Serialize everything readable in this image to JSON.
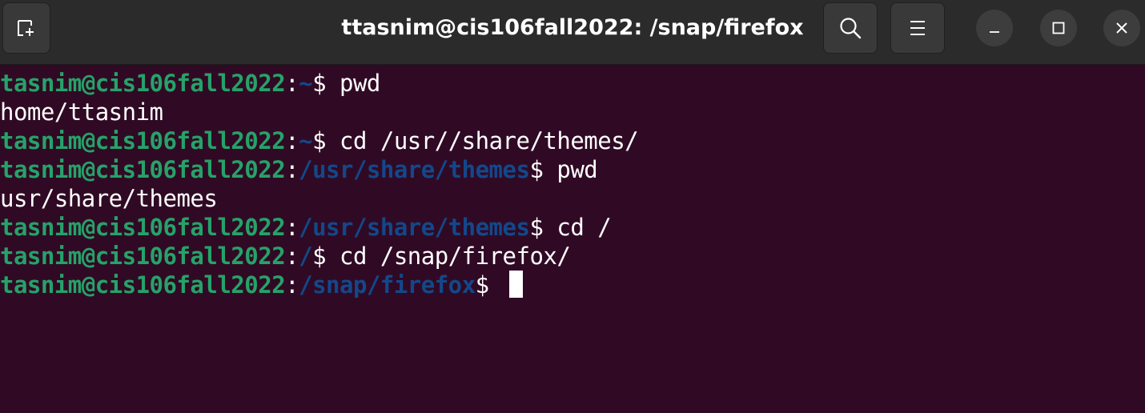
{
  "window": {
    "title": "ttasnim@cis106fall2022: /snap/firefox"
  },
  "headerbar": {
    "new_tab_icon": "new-tab-icon",
    "search_icon": "search-icon",
    "menu_icon": "hamburger-menu-icon",
    "minimize_icon": "minimize-icon",
    "maximize_icon": "maximize-icon",
    "close_icon": "close-icon"
  },
  "colors": {
    "terminal_bg": "#300a24",
    "header_bg": "#2b2b2b",
    "prompt_user": "#26a269",
    "prompt_path": "#12488b",
    "text": "#ffffff"
  },
  "terminal": {
    "lines": [
      {
        "type": "prompt",
        "user": "tasnim@cis106fall2022",
        "sep": ":",
        "path": "~",
        "cmd": "$ pwd"
      },
      {
        "type": "output",
        "text": "home/ttasnim"
      },
      {
        "type": "prompt",
        "user": "tasnim@cis106fall2022",
        "sep": ":",
        "path": "~",
        "cmd": "$ cd /usr//share/themes/"
      },
      {
        "type": "prompt",
        "user": "tasnim@cis106fall2022",
        "sep": ":",
        "path": "/usr/share/themes",
        "cmd": "$ pwd"
      },
      {
        "type": "output",
        "text": "usr/share/themes"
      },
      {
        "type": "prompt",
        "user": "tasnim@cis106fall2022",
        "sep": ":",
        "path": "/usr/share/themes",
        "cmd": "$ cd /"
      },
      {
        "type": "prompt",
        "user": "tasnim@cis106fall2022",
        "sep": ":",
        "path": "/",
        "cmd": "$ cd /snap/firefox/"
      },
      {
        "type": "prompt",
        "user": "tasnim@cis106fall2022",
        "sep": ":",
        "path": "/snap/firefox",
        "cmd": "$ ",
        "cursor": true
      }
    ]
  }
}
